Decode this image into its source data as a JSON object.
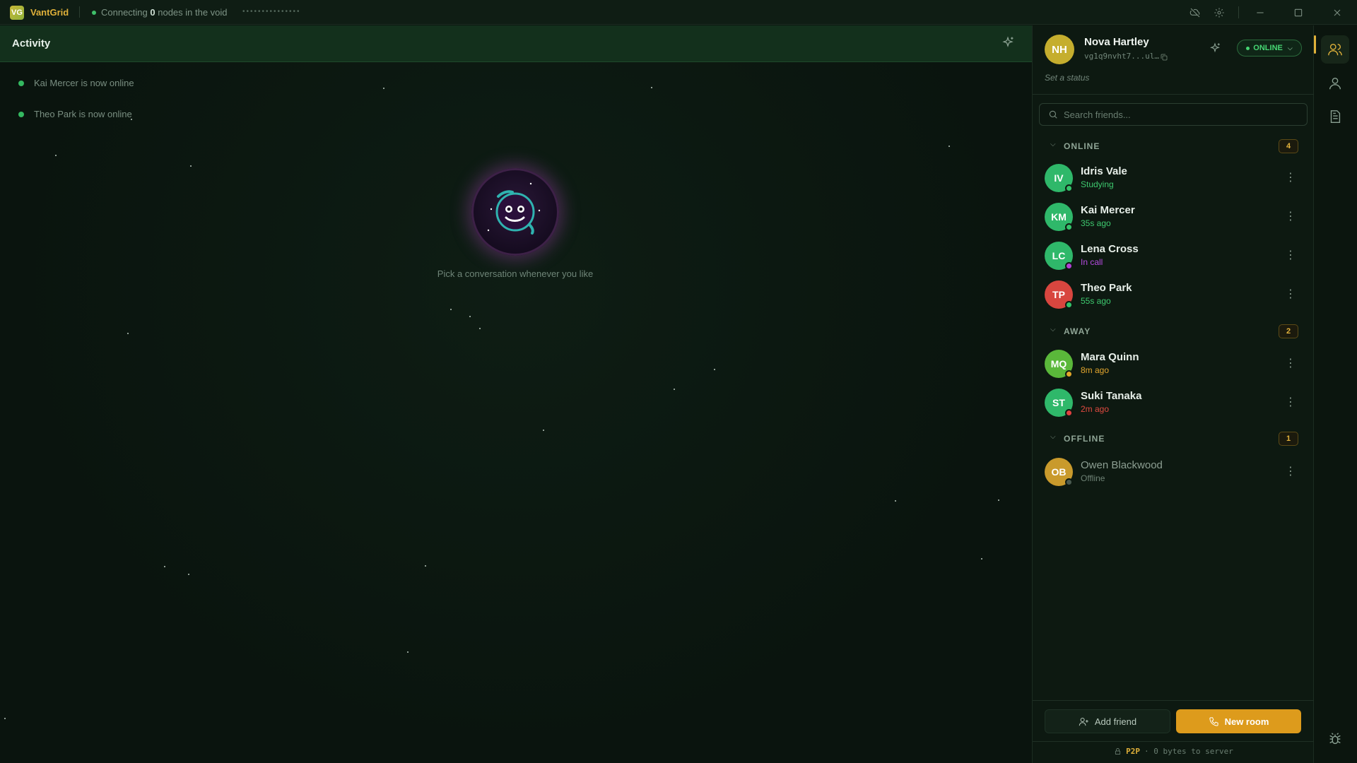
{
  "titlebar": {
    "logo_text": "VG",
    "app_name": "VantGrid",
    "connecting_prefix": "Connecting ",
    "node_count": "0",
    "connecting_suffix": " nodes in the void",
    "progress_dots": "•••••••••••••••",
    "icons": [
      "cloud-off-icon",
      "gear-icon",
      "minimize-icon",
      "maximize-icon",
      "close-icon"
    ]
  },
  "activity": {
    "title": "Activity",
    "items": [
      {
        "text": "Kai Mercer is now online"
      },
      {
        "text": "Theo Park is now online"
      }
    ],
    "empty_text": "Pick a conversation whenever you like"
  },
  "profile": {
    "initials": "NH",
    "name": "Nova Hartley",
    "id": "vg1q9nvht7...ul…",
    "status_label": "ONLINE",
    "set_status": "Set a status"
  },
  "search": {
    "placeholder": "Search friends..."
  },
  "groups": [
    {
      "title": "ONLINE",
      "count": "4",
      "friends": [
        {
          "initials": "IV",
          "name": "Idris Vale",
          "sub": "Studying",
          "avatar_color": "#2fb86a",
          "status_color": "#34c36a",
          "sub_color": "#3ec96f"
        },
        {
          "initials": "KM",
          "name": "Kai Mercer",
          "sub": "35s ago",
          "avatar_color": "#2fb86a",
          "status_color": "#34c36a",
          "sub_color": "#3ec96f"
        },
        {
          "initials": "LC",
          "name": "Lena Cross",
          "sub": "In call",
          "avatar_color": "#2fb86a",
          "status_color": "#b13fd6",
          "sub_color": "#b54be0"
        },
        {
          "initials": "TP",
          "name": "Theo Park",
          "sub": "55s ago",
          "avatar_color": "#d8463f",
          "status_color": "#34c36a",
          "sub_color": "#3ec96f"
        }
      ]
    },
    {
      "title": "AWAY",
      "count": "2",
      "friends": [
        {
          "initials": "MQ",
          "name": "Mara Quinn",
          "sub": "8m ago",
          "avatar_color": "#5ab83a",
          "status_color": "#e0a62a",
          "sub_color": "#e3a62e"
        },
        {
          "initials": "ST",
          "name": "Suki Tanaka",
          "sub": "2m ago",
          "avatar_color": "#2fb86a",
          "status_color": "#e04040",
          "sub_color": "#e04a40"
        }
      ]
    },
    {
      "title": "OFFLINE",
      "count": "1",
      "friends": [
        {
          "initials": "OB",
          "name": "Owen Blackwood",
          "sub": "Offline",
          "avatar_color": "#c99a2c",
          "status_color": "#4a5a50",
          "sub_color": "#6e8275",
          "dim": true
        }
      ]
    }
  ],
  "footer": {
    "add_friend": "Add friend",
    "new_room": "New room",
    "p2p_label": "P2P",
    "p2p_text": "· 0 bytes to server"
  },
  "rail": {
    "items": [
      "friends-icon",
      "contacts-icon",
      "notes-icon",
      "bug-icon"
    ]
  },
  "colors": {
    "accent": "#e0b13a",
    "online": "#34c36a",
    "header_bg": "#13301c"
  }
}
